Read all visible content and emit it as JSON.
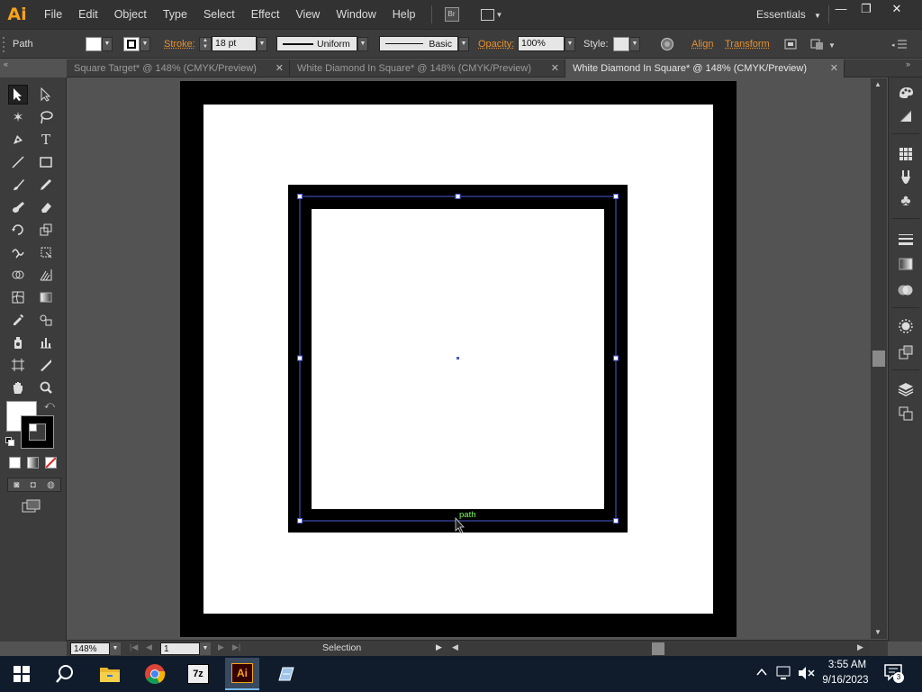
{
  "app": {
    "logo": "Ai",
    "workspace": "Essentials"
  },
  "menu": [
    "File",
    "Edit",
    "Object",
    "Type",
    "Select",
    "Effect",
    "View",
    "Window",
    "Help"
  ],
  "bridge_label": "Br",
  "window_controls": {
    "minimize": "—",
    "restore": "❐",
    "close": "✕"
  },
  "control": {
    "selection_type": "Path",
    "stroke_label": "Stroke:",
    "stroke_weight": "18 pt",
    "profile": "Uniform",
    "brush": "Basic",
    "opacity_label": "Opacity:",
    "opacity": "100%",
    "style_label": "Style:",
    "align_label": "Align",
    "transform_label": "Transform"
  },
  "tabs": [
    {
      "label": "Square Target* @ 148% (CMYK/Preview)",
      "close": "✕"
    },
    {
      "label": "White Diamond In Square* @ 148% (CMYK/Preview)",
      "close": "✕"
    },
    {
      "label": "White Diamond In Square* @ 148% (CMYK/Preview)",
      "close": "✕",
      "active": true
    }
  ],
  "canvas": {
    "hover_label": "path"
  },
  "status": {
    "zoom": "148%",
    "artboard": "1",
    "tool": "Selection"
  },
  "taskbar": {
    "time": "3:55 AM",
    "date": "9/16/2023",
    "notification_count": "3",
    "apps": [
      "7z",
      "Ai"
    ]
  },
  "colors": {
    "accent": "#e8922e",
    "selection": "#4a5bd6",
    "hover_label": "#7cff5a",
    "ai_brand": "#f7a21b"
  }
}
